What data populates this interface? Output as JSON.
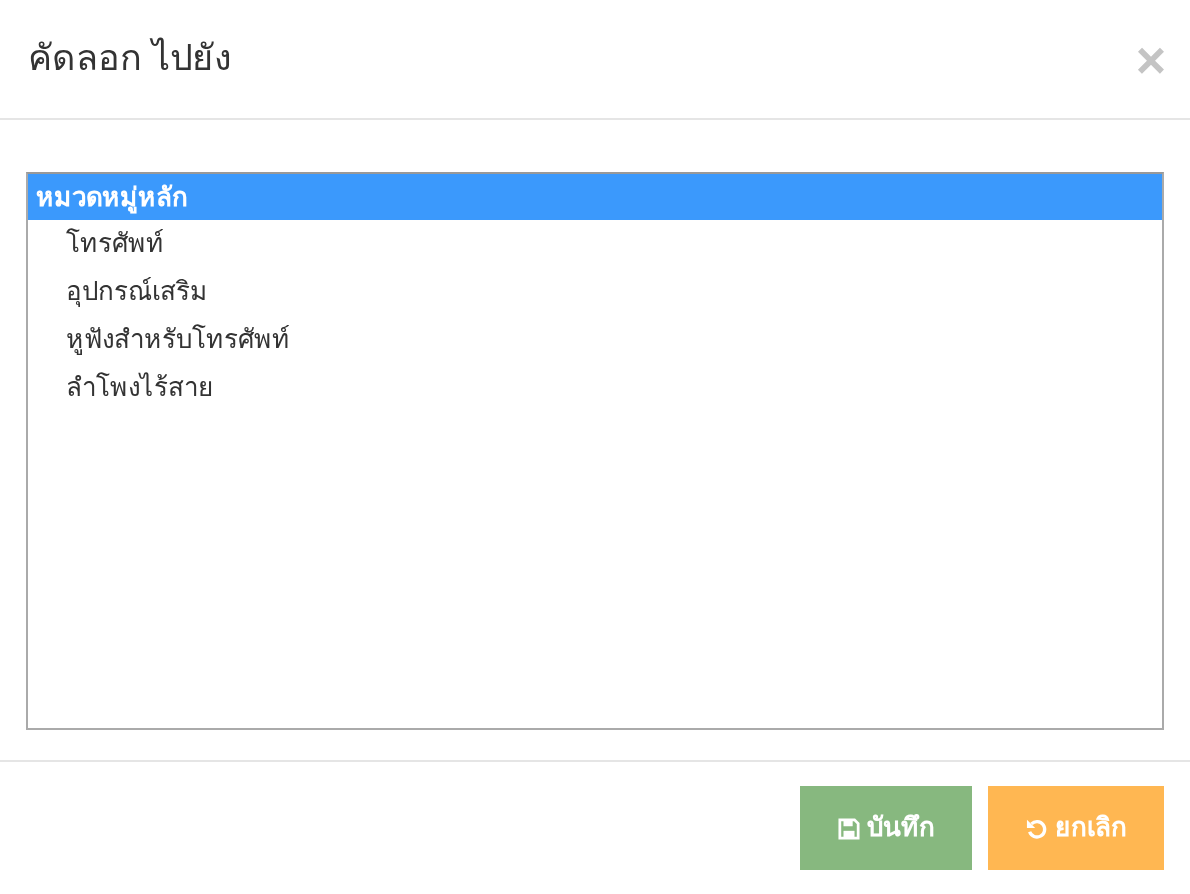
{
  "dialog": {
    "title": "คัดลอก ไปยัง",
    "close": "×"
  },
  "categories": [
    {
      "label": "หมวดหมู่หลัก",
      "selected": true,
      "children": [
        {
          "label": "โทรศัพท์",
          "selected": false
        },
        {
          "label": "อุปกรณ์เสริม",
          "selected": false
        },
        {
          "label": "หูฟังสำหรับโทรศัพท์",
          "selected": false
        },
        {
          "label": "ลำโพงไร้สาย",
          "selected": false
        }
      ]
    }
  ],
  "buttons": [
    {
      "kind": "save",
      "label": "บันทึก"
    },
    {
      "kind": "cancel",
      "label": "ยกเลิก"
    }
  ]
}
